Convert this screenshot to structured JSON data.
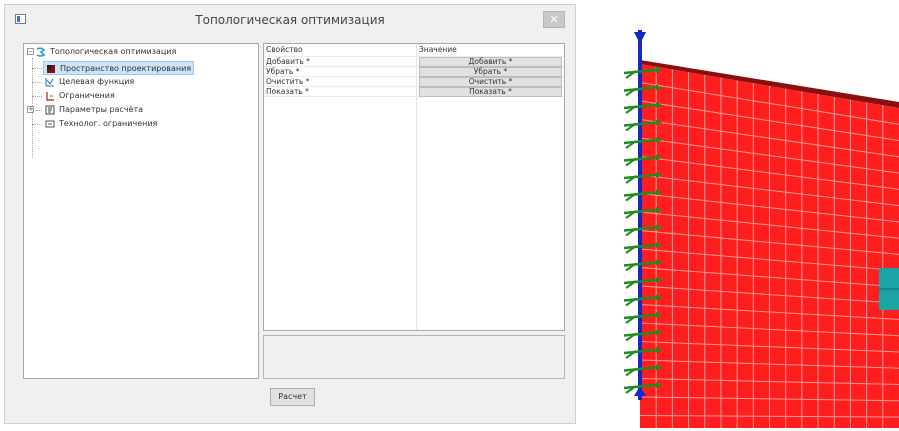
{
  "window": {
    "title": "Топологическая оптимизация",
    "close_glyph": "×"
  },
  "tree": {
    "root": "Топологическая оптимизация",
    "items": [
      {
        "label": "Пространство проектирования",
        "icon": "design-space-icon",
        "selected": true
      },
      {
        "label": "Целевая функция",
        "icon": "objective-function-icon"
      },
      {
        "label": "Ограничения",
        "icon": "constraints-icon"
      },
      {
        "label": "Параметры расчёта",
        "icon": "calc-parameters-icon",
        "expandable": true
      },
      {
        "label": "Технолог. ограничения",
        "icon": "tech-constraints-icon"
      }
    ]
  },
  "grid": {
    "headers": {
      "property": "Свойство",
      "value": "Значение"
    },
    "rows": [
      {
        "property": "Добавить *",
        "value": "Добавить *"
      },
      {
        "property": "Убрать *",
        "value": "Убрать *"
      },
      {
        "property": "Очистить *",
        "value": "Очистить *"
      },
      {
        "property": "Показать *",
        "value": "Показать *"
      }
    ]
  },
  "buttons": {
    "calculate": "Расчет"
  },
  "colors": {
    "mesh_fill": "#ff1e1e",
    "mesh_lines": "#ff9a9a",
    "support_blue": "#1428c8",
    "constraint_green": "#1e8c1e",
    "load_teal": "#1ca3a3"
  }
}
